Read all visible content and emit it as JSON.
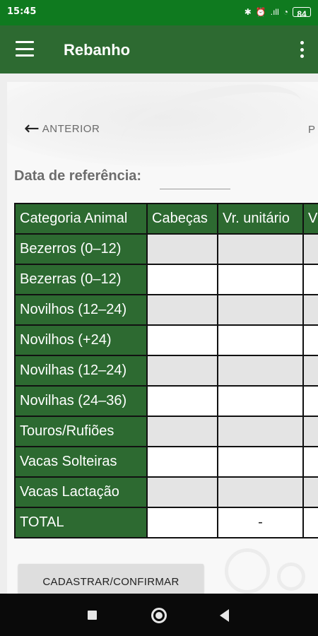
{
  "status_bar": {
    "time": "15:45",
    "signal_text": ".ıll",
    "battery": "84",
    "icons": [
      "bluetooth-icon",
      "alarm-icon",
      "signal-icon",
      "wifi-icon",
      "battery-icon"
    ]
  },
  "app_bar": {
    "title": "Rebanho",
    "menu_icon": "hamburger-menu-icon",
    "overflow_icon": "overflow-menu-icon"
  },
  "nav": {
    "previous_label": "ANTERIOR",
    "next_label_partial": "P"
  },
  "form": {
    "date_label": "Data de referência:",
    "date_value": ""
  },
  "table": {
    "headers": [
      "Categoria Animal",
      "Cabeças",
      "Vr. unitário",
      "V"
    ],
    "rows": [
      {
        "category": "Bezerros (0–12)",
        "cabecas": "",
        "vr_unitario": "",
        "valor": ""
      },
      {
        "category": "Bezerras (0–12)",
        "cabecas": "",
        "vr_unitario": "",
        "valor": ""
      },
      {
        "category": "Novilhos (12–24)",
        "cabecas": "",
        "vr_unitario": "",
        "valor": ""
      },
      {
        "category": "Novilhos (+24)",
        "cabecas": "",
        "vr_unitario": "",
        "valor": ""
      },
      {
        "category": "Novilhas (12–24)",
        "cabecas": "",
        "vr_unitario": "",
        "valor": ""
      },
      {
        "category": "Novilhas (24–36)",
        "cabecas": "",
        "vr_unitario": "",
        "valor": ""
      },
      {
        "category": "Touros/Rufiões",
        "cabecas": "",
        "vr_unitario": "",
        "valor": ""
      },
      {
        "category": "Vacas Solteiras",
        "cabecas": "",
        "vr_unitario": "",
        "valor": ""
      },
      {
        "category": "Vacas Lactação",
        "cabecas": "",
        "vr_unitario": "",
        "valor": ""
      },
      {
        "category": "TOTAL",
        "cabecas": "",
        "vr_unitario": "-",
        "valor": ""
      }
    ]
  },
  "actions": {
    "submit_label": "CADASTRAR/CONFIRMAR"
  },
  "colors": {
    "status_bar": "#0f7a1f",
    "app_bar": "#2d6a31",
    "table_header": "#2d6a31",
    "row_alt": "#e4e4e4",
    "nav_bar": "#0a0a0a"
  }
}
